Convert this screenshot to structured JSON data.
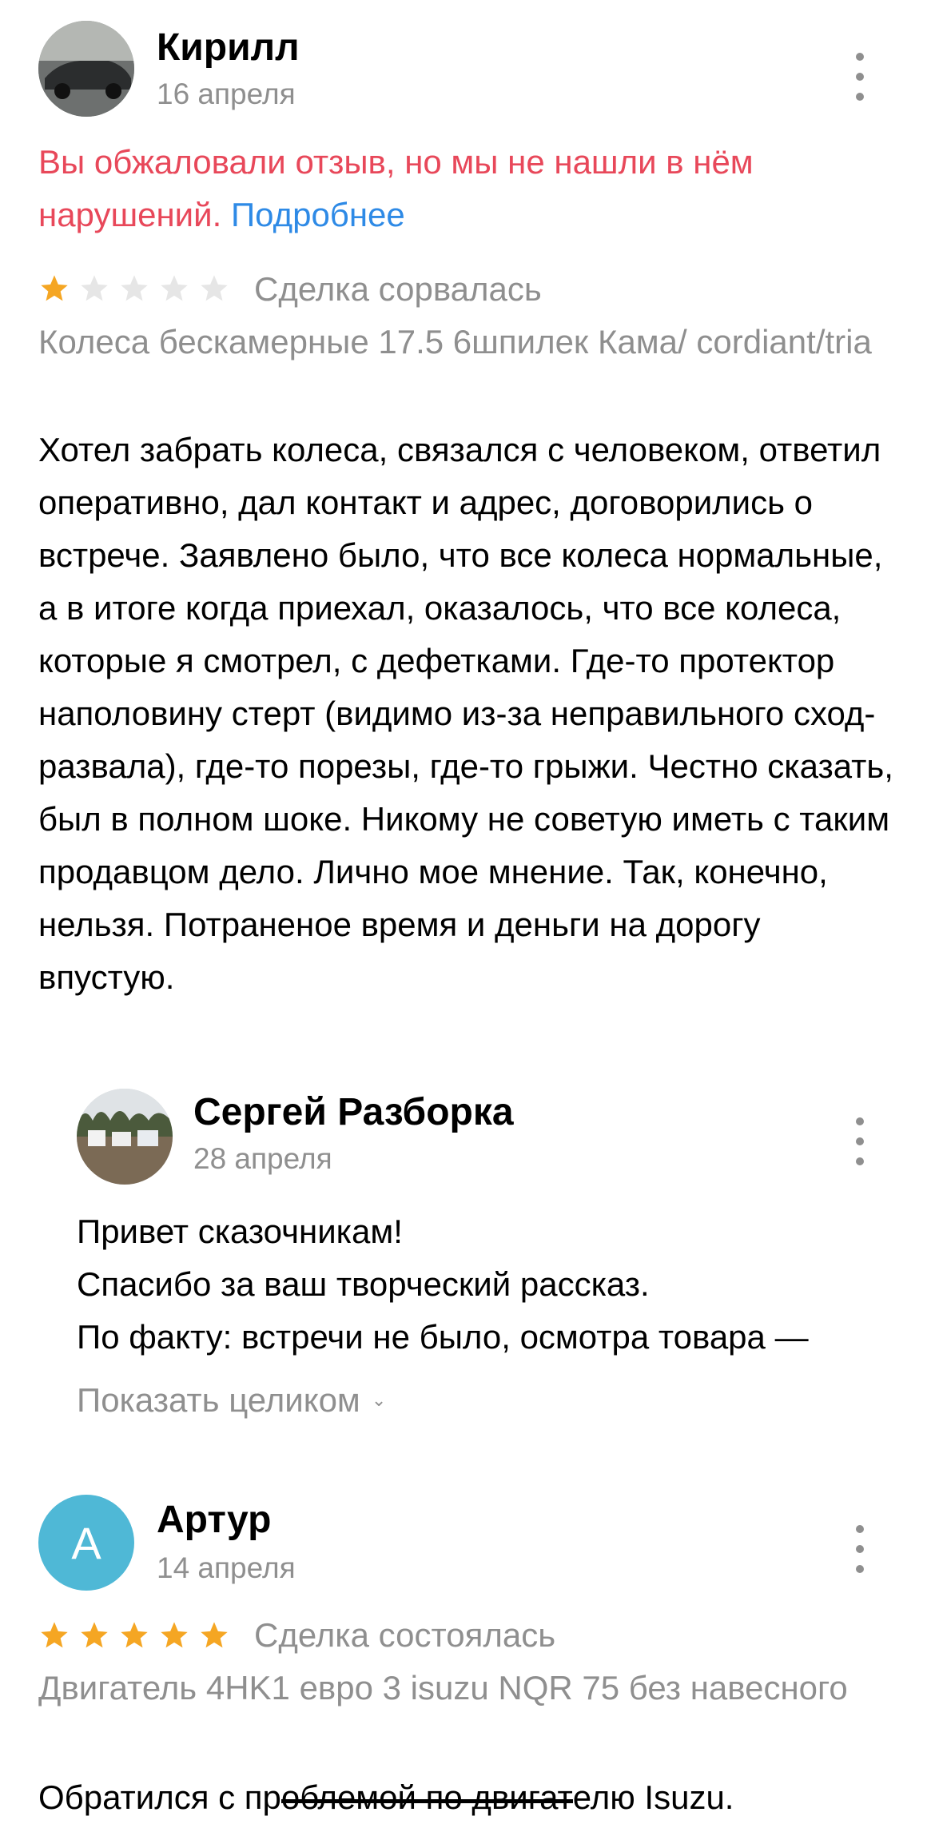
{
  "colors": {
    "star_filled": "#f5a623",
    "star_empty": "#e6e6e6",
    "warning": "#e8485a",
    "link": "#2e8ae6",
    "muted": "#8f8f8f",
    "avatar_letter_bg": "#4fb8d6"
  },
  "reviews": [
    {
      "author": "Кирилл",
      "date": "16 апреля",
      "moderation_warning": "Вы обжаловали отзыв, но мы не нашли в нём нарушений.",
      "moderation_link": "Подробнее",
      "rating": 1,
      "deal_status": "Сделка сорвалась",
      "item": "Колеса бескамерные 17.5 6шпилек Кама/ cordiant/tria",
      "text": "Хотел забрать колеса, связался с человеком, ответил оперативно, дал контакт и адрес, договорились о встрече. Заявлено было, что все колеса нормальные, а в итоге когда приехал, оказалось, что все колеса, которые я смотрел, с дефетками. Где-то протектор наполовину стерт (видимо из-за неправильного сход-развала), где-то порезы, где-то грыжи. Честно сказать, был в полном шоке. Никому не советую иметь с таким продавцом дело. Лично мое мнение. Так, конечно, нельзя. Потранeное время и деньги на дорогу впустую.",
      "reply": {
        "author": "Сергей Разборка",
        "date": "28 апреля",
        "lines": [
          "Привет сказочникам!",
          "Спасибо за ваш творческий рассказ.",
          "По факту: встречи не было, осмотра товара —"
        ],
        "show_full": "Показать целиком"
      }
    },
    {
      "author": "Артур",
      "avatar_letter": "А",
      "date": "14 апреля",
      "rating": 5,
      "deal_status": "Сделка состоялась",
      "item": "Двигатель 4HK1 евро 3 isuzu NQR 75 без навесного",
      "text_start": "Обратился с пр",
      "text_struck": "облемой по двигат",
      "text_end": "елю Isuzu."
    }
  ],
  "icons": {
    "menu": "more-vertical-icon",
    "star": "star-icon",
    "chevron": "chevron-down-icon"
  }
}
